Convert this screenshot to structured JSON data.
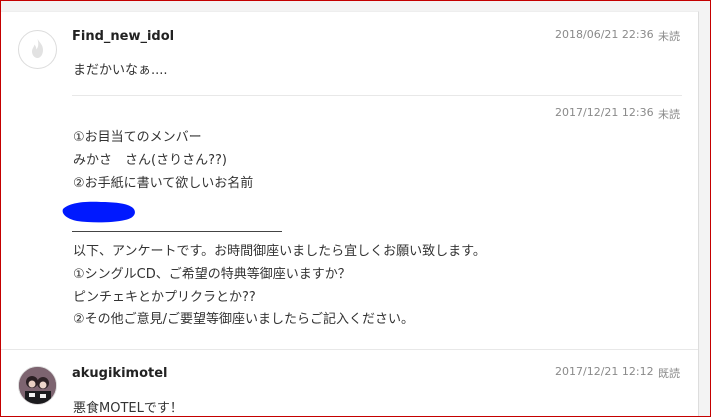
{
  "messages": [
    {
      "sender": "Find_new_idol",
      "timestamp": "2018/06/21 22:36",
      "status": "未読",
      "avatar_icon": "flame-icon",
      "body": "まだかいなぁ...."
    },
    {
      "timestamp": "2017/12/21 12:36",
      "status": "未読",
      "lines": [
        "①お目当てのメンバー",
        "みかさ　さん(さりさん??)",
        "②お手紙に書いて欲しいお名前",
        "",
        "",
        "以下、アンケートです。お時間御座いましたら宜しくお願い致します。",
        "①シングルCD、ご希望の特典等御座いますか？",
        "ピンチェキとかプリクラとか??",
        "②その他ご意見/ご要望等御座いましたらご記入ください。"
      ],
      "redaction_color": "#0019ff"
    },
    {
      "sender": "akugikimotel",
      "timestamp": "2017/12/21 12:12",
      "status": "既読",
      "avatar_icon": "user-photo-icon",
      "body": "悪食MOTELです！"
    }
  ],
  "colors": {
    "frame_border": "#c40000",
    "redaction": "#0019ff"
  }
}
